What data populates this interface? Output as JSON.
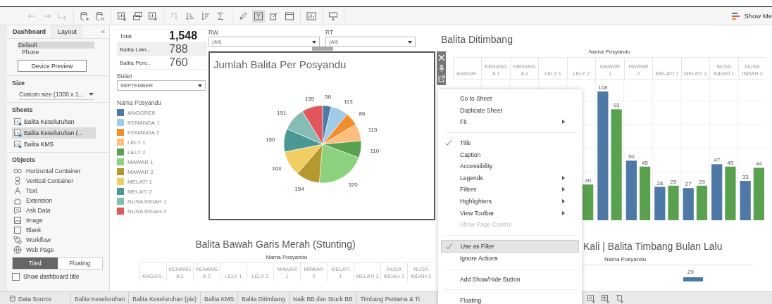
{
  "toolbar": {
    "groups": [
      [
        {
          "kind": "back",
          "disabled": true,
          "selected": false
        },
        {
          "kind": "forward",
          "disabled": true,
          "selected": false
        },
        {
          "kind": "redo",
          "disabled": true,
          "selected": false
        }
      ],
      [
        {
          "kind": "add-datasource",
          "disabled": false,
          "selected": false
        },
        {
          "kind": "pause",
          "disabled": false,
          "selected": false
        }
      ],
      [
        {
          "kind": "add-sheet",
          "disabled": false,
          "selected": false
        },
        {
          "kind": "duplicate",
          "disabled": false,
          "selected": false
        },
        {
          "kind": "clear",
          "disabled": false,
          "selected": false
        }
      ],
      [
        {
          "kind": "swap",
          "disabled": true,
          "selected": false
        },
        {
          "kind": "sort-asc",
          "disabled": false,
          "selected": false
        },
        {
          "kind": "sort-desc",
          "disabled": false,
          "selected": false
        },
        {
          "kind": "totals",
          "disabled": false,
          "selected": false
        }
      ],
      [
        {
          "kind": "highlight",
          "disabled": false,
          "selected": false
        },
        {
          "kind": "labels",
          "disabled": false,
          "selected": true
        },
        {
          "kind": "annotate",
          "disabled": false,
          "selected": false
        },
        {
          "kind": "frame",
          "disabled": false,
          "selected": false
        }
      ],
      [
        {
          "kind": "fit",
          "disabled": false,
          "selected": false
        }
      ],
      [
        {
          "kind": "present",
          "disabled": false,
          "selected": false
        }
      ]
    ],
    "show_me": "Show Me"
  },
  "sidebar": {
    "tabs": [
      {
        "label": "Dashboard",
        "selected": true
      },
      {
        "label": "Layout",
        "selected": false
      }
    ],
    "collapse": "<",
    "devices": [
      {
        "label": "Default",
        "selected": true
      },
      {
        "label": "Phone",
        "selected": false
      }
    ],
    "device_preview": "Device Preview",
    "size": {
      "heading": "Size",
      "value": "Custom size (1300 x 1..."
    },
    "sheets": {
      "heading": "Sheets",
      "items": [
        {
          "label": "Balita Keseluruhan",
          "selected": false
        },
        {
          "label": "Balita Keseluruhan (...",
          "selected": true
        },
        {
          "label": "Balita KMS",
          "selected": false
        }
      ]
    },
    "objects": {
      "heading": "Objects",
      "items": [
        {
          "label": "Horizontal Container",
          "kind": "horizontal"
        },
        {
          "label": "Vertical Container",
          "kind": "vertical"
        },
        {
          "label": "Text",
          "kind": "text"
        },
        {
          "label": "Extension",
          "kind": "extension"
        },
        {
          "label": "Ask Data",
          "kind": "ask-data"
        },
        {
          "label": "Image",
          "kind": "image"
        },
        {
          "label": "Blank",
          "kind": "blank"
        },
        {
          "label": "Workflow",
          "kind": "workflow"
        },
        {
          "label": "Web Page",
          "kind": "web-page"
        }
      ]
    },
    "layout_mode": [
      {
        "label": "Tiled",
        "selected": true
      },
      {
        "label": "Floating",
        "selected": false
      }
    ],
    "show_title": {
      "label": "Show dashboard title",
      "checked": false
    }
  },
  "kpis": [
    {
      "label": "Total",
      "value": "1,548",
      "selected": false
    },
    {
      "label": "Balita Laki-..",
      "value": "788",
      "selected": true
    },
    {
      "label": "Balita Pere..",
      "value": "760",
      "selected": false
    }
  ],
  "bulan_filter": {
    "label": "Bulan",
    "value": "SEPTEMBER"
  },
  "filters": [
    {
      "label": "RW",
      "value": "(All)"
    },
    {
      "label": "RT",
      "value": "(All)"
    }
  ],
  "legend": {
    "title": "Nama Posyandu",
    "items": [
      {
        "label": "ANGGREK",
        "color": "#4e79a7"
      },
      {
        "label": "KENANGA 1",
        "color": "#a0cbe8"
      },
      {
        "label": "KENANGA 2",
        "color": "#f28e2b"
      },
      {
        "label": "LELY 1",
        "color": "#ffbe7d"
      },
      {
        "label": "LELY 2",
        "color": "#59a14f"
      },
      {
        "label": "MAWAR 1",
        "color": "#8cd17d"
      },
      {
        "label": "MAWAR 2",
        "color": "#b6992d"
      },
      {
        "label": "MELATI 1",
        "color": "#f1ce63"
      },
      {
        "label": "MELATI 2",
        "color": "#499894"
      },
      {
        "label": "NUSA INDAH 1",
        "color": "#86bcb6"
      },
      {
        "label": "NUSA INDAH 2",
        "color": "#e15759"
      }
    ]
  },
  "pie": {
    "chart_data": {
      "type": "pie",
      "title": "Jumlah Balita Per Posyandu",
      "values": [
        56,
        113,
        86,
        110,
        110,
        320,
        154,
        163,
        150,
        151,
        135
      ],
      "data_labels": true
    }
  },
  "bar_chart": {
    "chart_data": {
      "type": "bar",
      "title": "Balita Ditimbang",
      "xlabel": "Nama Posyandu",
      "categories": [
        "ANGGR..",
        "KENANG\nA 1",
        "KENANG\nA 2",
        "LELY 1",
        "LELY 2",
        "MAWAR\n1",
        "MAWAR\n2",
        "MELATI 1",
        "MELATI 2",
        "NUSA\nINDAH 1",
        "NUSA\nINDAH 2"
      ],
      "series": [
        {
          "color": "#4e79a7",
          "values": [
            null,
            null,
            null,
            null,
            null,
            108,
            50,
            28,
            27,
            47,
            33
          ]
        },
        {
          "color": "#59a14f",
          "values": [
            null,
            null,
            null,
            null,
            30,
            93,
            45,
            29,
            29,
            45,
            44
          ]
        }
      ],
      "data_labels": true
    }
  },
  "stunting": {
    "title": "Balita Bawah Garis Merah (Stunting)",
    "header": "Nama Posyandu",
    "columns": [
      "ANGGR..",
      "KENANG\nA 1",
      "KENANG\nA 2",
      "LELY 1",
      "LELY 2",
      "MAWAR\n1",
      "MAWAR\n2",
      "MELATI\n1",
      "MELATI 2",
      "NUSA\nINDAH 1",
      "NUSA\nINDAH 2"
    ]
  },
  "weighing": {
    "title": "Kali | Balita Timbang Bulan Lalu",
    "header": "Nama Posyandu",
    "bar_label": "29"
  },
  "context_menu": {
    "items": [
      {
        "kind": "item",
        "label": "Go to Sheet",
        "checked": false,
        "submenu": false,
        "disabled": false,
        "selected": false
      },
      {
        "kind": "item",
        "label": "Duplicate Sheet",
        "checked": false,
        "submenu": false,
        "disabled": false,
        "selected": false
      },
      {
        "kind": "item",
        "label": "Fit",
        "checked": false,
        "submenu": true,
        "disabled": false,
        "selected": false
      },
      {
        "kind": "separator"
      },
      {
        "kind": "item",
        "label": "Title",
        "checked": true,
        "submenu": false,
        "disabled": false,
        "selected": false
      },
      {
        "kind": "item",
        "label": "Caption",
        "checked": false,
        "submenu": false,
        "disabled": false,
        "selected": false
      },
      {
        "kind": "item",
        "label": "Accessibility",
        "checked": false,
        "submenu": false,
        "disabled": false,
        "selected": false
      },
      {
        "kind": "item",
        "label": "Legends",
        "checked": false,
        "submenu": true,
        "disabled": false,
        "selected": false
      },
      {
        "kind": "item",
        "label": "Filters",
        "checked": false,
        "submenu": true,
        "disabled": false,
        "selected": false
      },
      {
        "kind": "item",
        "label": "Highlighters",
        "checked": false,
        "submenu": true,
        "disabled": false,
        "selected": false
      },
      {
        "kind": "item",
        "label": "View Toolbar",
        "checked": false,
        "submenu": true,
        "disabled": false,
        "selected": false
      },
      {
        "kind": "item",
        "label": "Show Page Control",
        "checked": false,
        "submenu": false,
        "disabled": true,
        "selected": false
      },
      {
        "kind": "separator"
      },
      {
        "kind": "item",
        "label": "Use as Filter",
        "checked": true,
        "submenu": false,
        "disabled": false,
        "selected": true
      },
      {
        "kind": "item",
        "label": "Ignore Actions",
        "checked": false,
        "submenu": false,
        "disabled": false,
        "selected": false
      },
      {
        "kind": "separator"
      },
      {
        "kind": "item",
        "label": "Add Show/Hide Button",
        "checked": false,
        "submenu": false,
        "disabled": false,
        "selected": false
      },
      {
        "kind": "separator"
      },
      {
        "kind": "item",
        "label": "Floating",
        "checked": false,
        "submenu": false,
        "disabled": false,
        "selected": false
      }
    ]
  },
  "sheet_tabs": {
    "data_source": "Data Source",
    "tabs": [
      "Balita Keseluruhan",
      "Balita Keseluruhan (pie)",
      "Balita KMS",
      "Balita Ditimbang",
      "Naik BB dan Stuck BB",
      "Timbang Pertama & Ti"
    ]
  }
}
